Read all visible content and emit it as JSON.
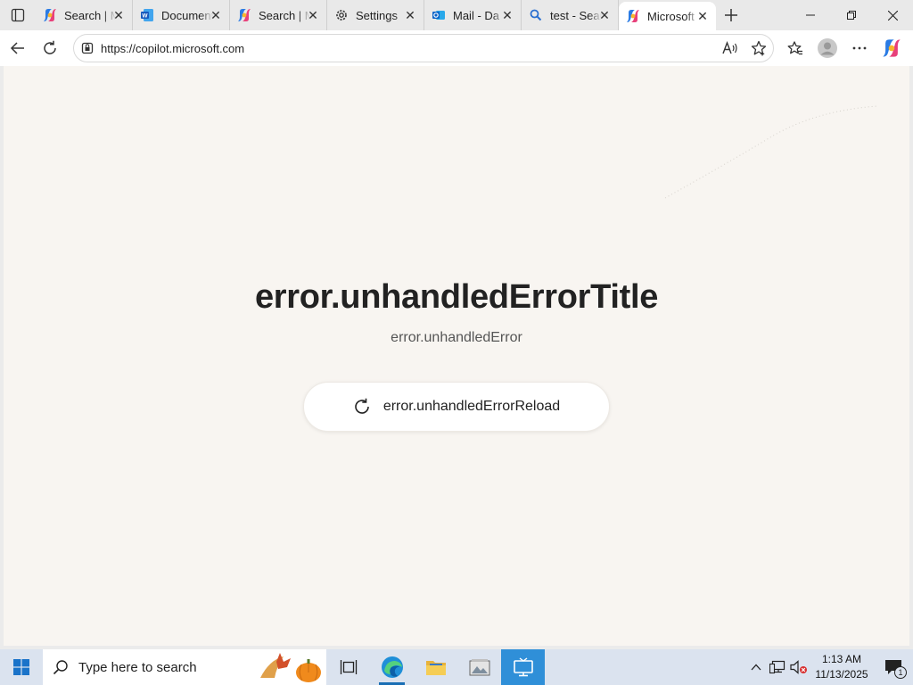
{
  "browser": {
    "tabs": [
      {
        "title": "Search | Microsoft",
        "icon": "copilot-icon",
        "active": false
      },
      {
        "title": "Document",
        "icon": "word-icon",
        "active": false
      },
      {
        "title": "Search | Microsoft",
        "icon": "copilot-icon",
        "active": false
      },
      {
        "title": "Settings",
        "icon": "gear-icon",
        "active": false
      },
      {
        "title": "Mail - Da",
        "icon": "outlook-icon",
        "active": false
      },
      {
        "title": "test - Search",
        "icon": "search-icon",
        "active": false
      },
      {
        "title": "Microsoft",
        "icon": "copilot-icon",
        "active": true
      }
    ],
    "address": {
      "url": "https://copilot.microsoft.com"
    }
  },
  "page": {
    "title": "error.unhandledErrorTitle",
    "subtitle": "error.unhandledError",
    "reload_label": "error.unhandledErrorReload"
  },
  "taskbar": {
    "search_placeholder": "Type here to search",
    "time": "1:13 AM",
    "date": "11/13/2025",
    "notification_count": "1"
  },
  "colors": {
    "page_bg": "#f8f5f1",
    "taskbar_bg": "#dbe3ef",
    "accent": "#2f8fd8"
  }
}
